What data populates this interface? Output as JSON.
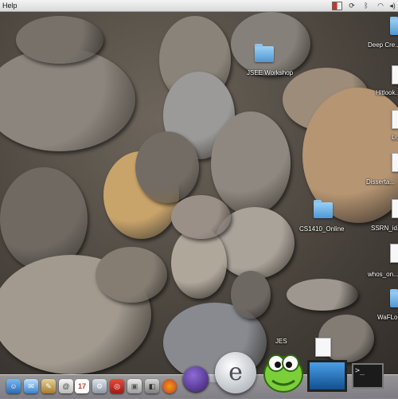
{
  "menubar": {
    "menu_label": "Help",
    "status_icons": [
      "flag-icon",
      "sync-icon",
      "bluetooth-icon",
      "wifi-icon",
      "volume-icon"
    ]
  },
  "desktop": {
    "icons": [
      {
        "name": "folder",
        "label": "JSEE Workshop"
      },
      {
        "name": "folder",
        "label": "Deep Cre..."
      },
      {
        "name": "document",
        "label": "Hitlook..."
      },
      {
        "name": "document",
        "label": "Lo..."
      },
      {
        "name": "document",
        "label": "Disserta..."
      },
      {
        "name": "folder",
        "label": "CS1410_Online"
      },
      {
        "name": "document",
        "label": "SSRN_id..."
      },
      {
        "name": "document",
        "label": "whos_on..."
      },
      {
        "name": "folder",
        "label": "WaFLo..."
      },
      {
        "name": "document",
        "label": "JES"
      }
    ]
  },
  "dock": {
    "apps": [
      "finder-icon",
      "mail-icon",
      "ichat-icon",
      "address-book-icon",
      "ical-icon",
      "system-preferences-icon",
      "safari-icon",
      "photo-icon",
      "preview-icon",
      "firefox-icon",
      "terminal-icon"
    ],
    "calendar_date": "17",
    "eclipse_letter": "e",
    "python_app": "python-launcher-icon",
    "movie_app": "imovie-icon",
    "terminal_app": "terminal-window-icon"
  },
  "colors": {
    "folder_blue": "#4f97d4",
    "menubar_bg": "#e6e6e6",
    "dock_bg": "#b4b4be"
  }
}
